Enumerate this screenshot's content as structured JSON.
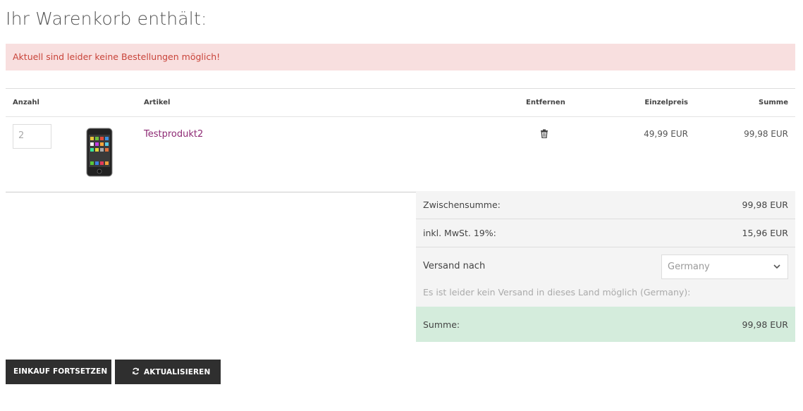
{
  "page_title": "Ihr Warenkorb enthält:",
  "alert": "Aktuell sind leider keine Bestellungen möglich!",
  "table": {
    "headers": {
      "quantity": "Anzahl",
      "article": "Artikel",
      "remove": "Entfernen",
      "unit_price": "Einzelpreis",
      "total": "Summe"
    },
    "items": [
      {
        "quantity": "2",
        "name": "Testprodukt2",
        "image_icon": "smartphone-thumbnail",
        "remove_icon": "trash-icon",
        "unit_price": "49,99 EUR",
        "total": "99,98 EUR"
      }
    ]
  },
  "totals": {
    "subtotal_label": "Zwischensumme:",
    "subtotal_value": "99,98 EUR",
    "vat_label": "inkl. MwSt. 19%:",
    "vat_value": "15,96 EUR",
    "shipping_label": "Versand nach",
    "shipping_country": "Germany",
    "shipping_note": "Es ist leider kein Versand in dieses Land möglich (Germany):",
    "sum_label": "Summe:",
    "sum_value": "99,98 EUR"
  },
  "buttons": {
    "continue": "EINKAUF FORTSETZEN",
    "update": "AKTUALISIEREN"
  },
  "colors": {
    "alert_bg": "#f8dfdf",
    "alert_text": "#c9443a",
    "link": "#8e2a74",
    "total_bg": "#d4ecdc",
    "button_bg": "#2f2f2f"
  }
}
